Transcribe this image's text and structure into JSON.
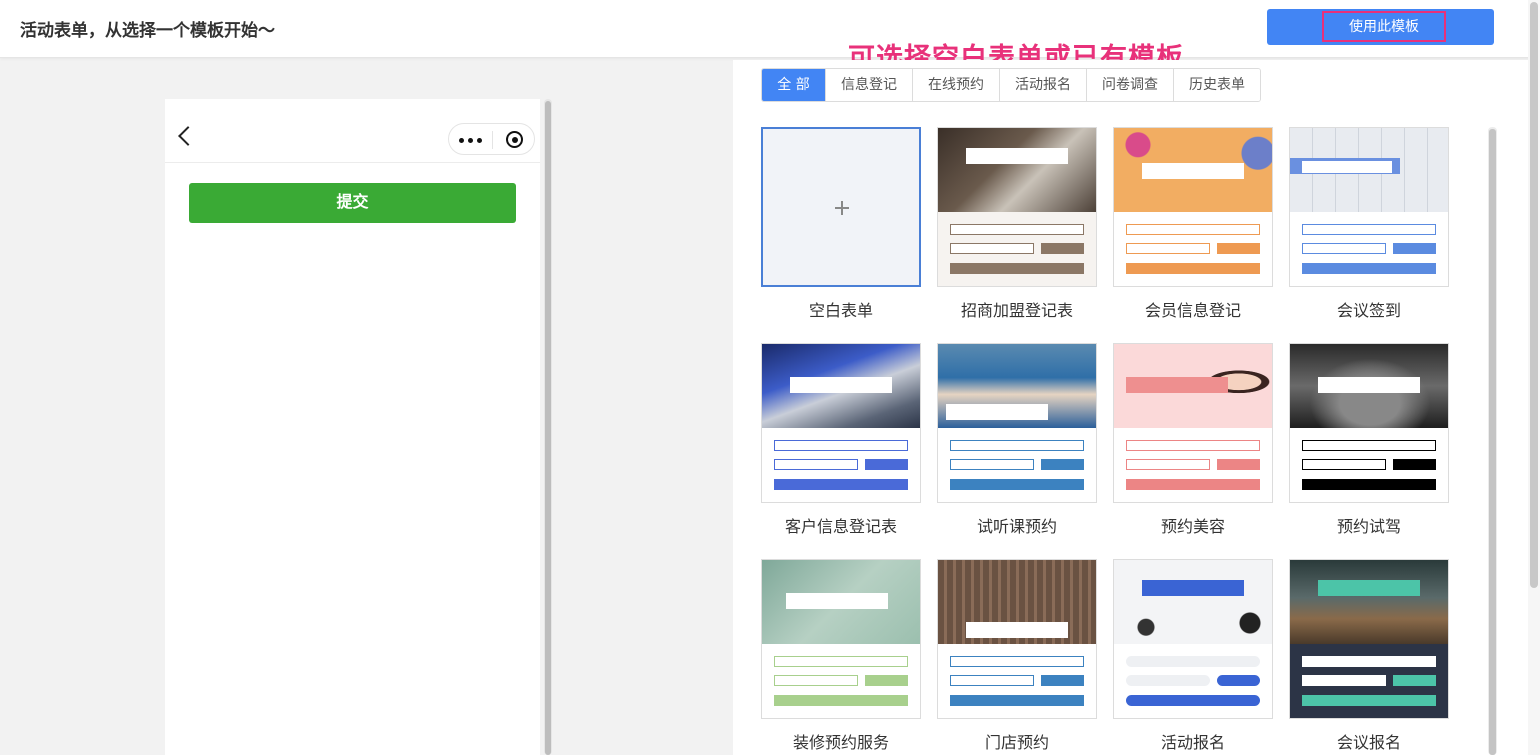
{
  "header": {
    "title": "活动表单，从选择一个模板开始～",
    "use_template_button": "使用此模板"
  },
  "annotation": "可选择空白表单或已有模板",
  "preview": {
    "submit_button": "提交"
  },
  "tabs": [
    {
      "label": "全 部",
      "active": true
    },
    {
      "label": "信息登记",
      "active": false
    },
    {
      "label": "在线预约",
      "active": false
    },
    {
      "label": "活动报名",
      "active": false
    },
    {
      "label": "问卷调查",
      "active": false
    },
    {
      "label": "历史表单",
      "active": false
    }
  ],
  "templates": [
    {
      "label": "空白表单",
      "style": "blank"
    },
    {
      "label": "招商加盟登记表",
      "style": "office",
      "accent": "#8b7766"
    },
    {
      "label": "会员信息登记",
      "style": "party",
      "accent": "#ee9a52"
    },
    {
      "label": "会议签到",
      "style": "calendar",
      "accent": "#5b8be0"
    },
    {
      "label": "客户信息登记表",
      "style": "building",
      "accent": "#4a6ad8"
    },
    {
      "label": "试听课预约",
      "style": "students",
      "accent": "#3c82c0"
    },
    {
      "label": "预约美容",
      "style": "beauty",
      "accent": "#ec8585"
    },
    {
      "label": "预约试驾",
      "style": "car",
      "accent": "#000000"
    },
    {
      "label": "装修预约服务",
      "style": "interior",
      "accent": "#a8d08d"
    },
    {
      "label": "门店预约",
      "style": "store",
      "accent": "#3c82c0"
    },
    {
      "label": "活动报名",
      "style": "desk",
      "accent": "#3a64d4"
    },
    {
      "label": "会议报名",
      "style": "meeting",
      "accent": "#4cc4a8"
    }
  ]
}
